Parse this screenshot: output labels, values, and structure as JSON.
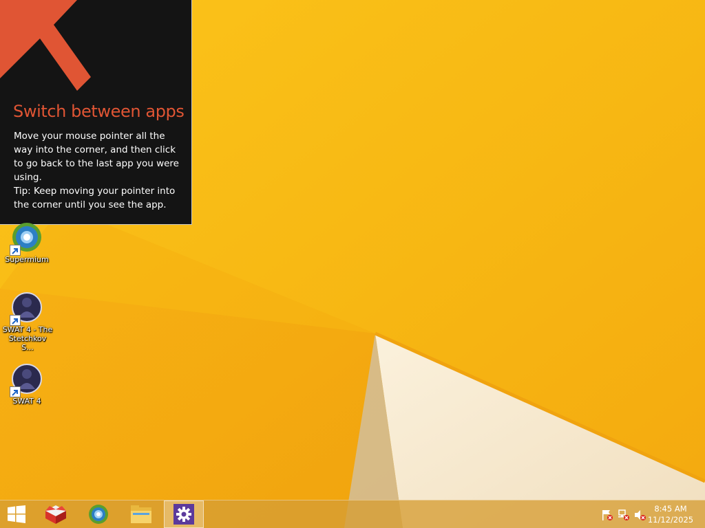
{
  "tip": {
    "title": "Switch between apps",
    "body_line1": "Move your mouse pointer all the way into the corner, and then click to go back to the last app you were using.",
    "body_line2": "Tip: Keep moving your pointer into the corner until you see the app.",
    "arrow_icon": "arrow-up-left-icon",
    "accent_color": "#e05534"
  },
  "desktop": {
    "icons": [
      {
        "label": "Supermium",
        "icon": "supermium-browser-icon"
      },
      {
        "label": "SWAT 4 - The Stetchkov S...",
        "icon": "swat4-game-icon"
      },
      {
        "label": "SWAT 4",
        "icon": "swat4-game-icon"
      }
    ]
  },
  "taskbar": {
    "start_icon": "windows-start-icon",
    "pinned": [
      {
        "name": "Game launcher",
        "icon": "box-app-icon"
      },
      {
        "name": "Supermium",
        "icon": "supermium-browser-icon"
      },
      {
        "name": "File Explorer",
        "icon": "folder-icon"
      },
      {
        "name": "Settings",
        "icon": "gear-icon",
        "active": true
      }
    ],
    "tray": [
      {
        "name": "Action Center",
        "icon": "flag-warning-icon"
      },
      {
        "name": "Network",
        "icon": "network-icon"
      },
      {
        "name": "Volume",
        "icon": "speaker-muted-icon"
      }
    ],
    "clock": {
      "time": "8:45 AM",
      "date": "11/12/2025"
    }
  },
  "colors": {
    "wallpaper": "#f6b416",
    "tip_background": "#141414"
  }
}
